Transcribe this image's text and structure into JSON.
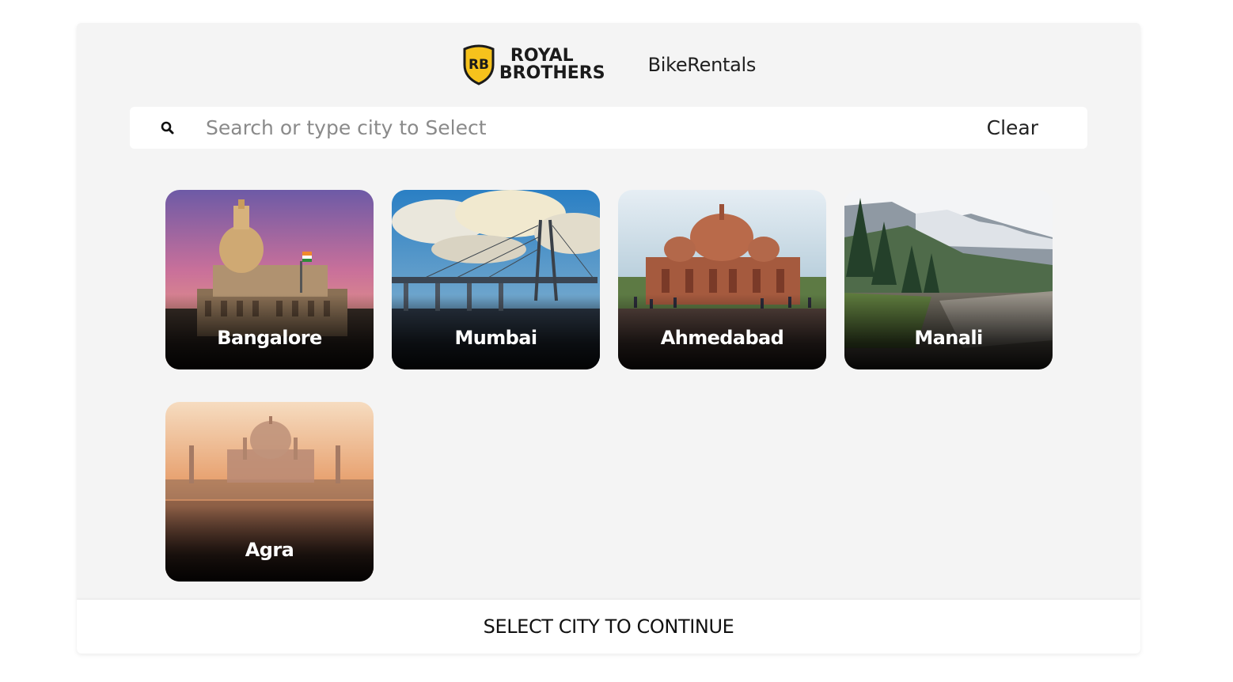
{
  "brand": {
    "logo_line1": "ROYAL",
    "logo_line2": "BROTHERS",
    "logo_badge": "RB",
    "title": "BikeRentals",
    "accent": "#f6c21c"
  },
  "search": {
    "placeholder": "Search or type city to Select",
    "value": "",
    "clear_label": "Clear",
    "icon": "search-icon"
  },
  "cities": [
    {
      "name": "Bangalore"
    },
    {
      "name": "Mumbai"
    },
    {
      "name": "Ahmedabad"
    },
    {
      "name": "Manali"
    },
    {
      "name": "Agra"
    }
  ],
  "footer": {
    "continue_label": "SELECT CITY TO CONTINUE"
  }
}
